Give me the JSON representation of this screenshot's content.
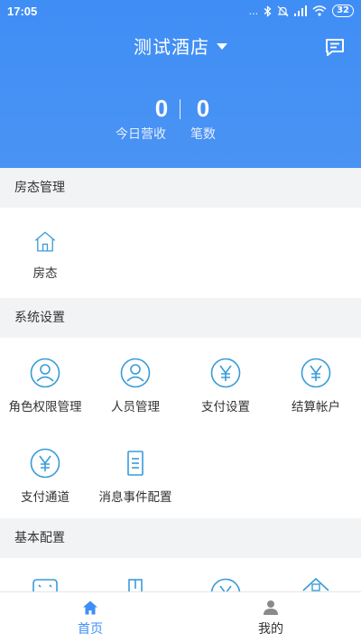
{
  "status_bar": {
    "time": "17:05",
    "signal": "...",
    "battery": "32"
  },
  "header": {
    "title": "测试酒店"
  },
  "stats": [
    {
      "value": "0",
      "label": "今日营收"
    },
    {
      "value": "0",
      "label": "笔数"
    }
  ],
  "sections": {
    "room": {
      "title": "房态管理",
      "items": [
        {
          "label": "房态",
          "icon": "house-icon"
        }
      ]
    },
    "system": {
      "title": "系统设置",
      "items": [
        {
          "label": "角色权限管理",
          "icon": "user-circle-icon"
        },
        {
          "label": "人员管理",
          "icon": "user-circle-icon"
        },
        {
          "label": "支付设置",
          "icon": "yen-circle-icon"
        },
        {
          "label": "结算帐户",
          "icon": "yen-circle-icon"
        },
        {
          "label": "支付通道",
          "icon": "yen-circle-icon"
        },
        {
          "label": "消息事件配置",
          "icon": "document-icon"
        }
      ]
    },
    "basic": {
      "title": "基本配置"
    }
  },
  "tabbar": [
    {
      "label": "首页",
      "icon": "home-icon",
      "active": true
    },
    {
      "label": "我的",
      "icon": "person-icon",
      "active": false
    }
  ],
  "colors": {
    "primary": "#3f8ef5",
    "icon_stroke": "#3a9bd8",
    "background": "#f2f3f5"
  }
}
